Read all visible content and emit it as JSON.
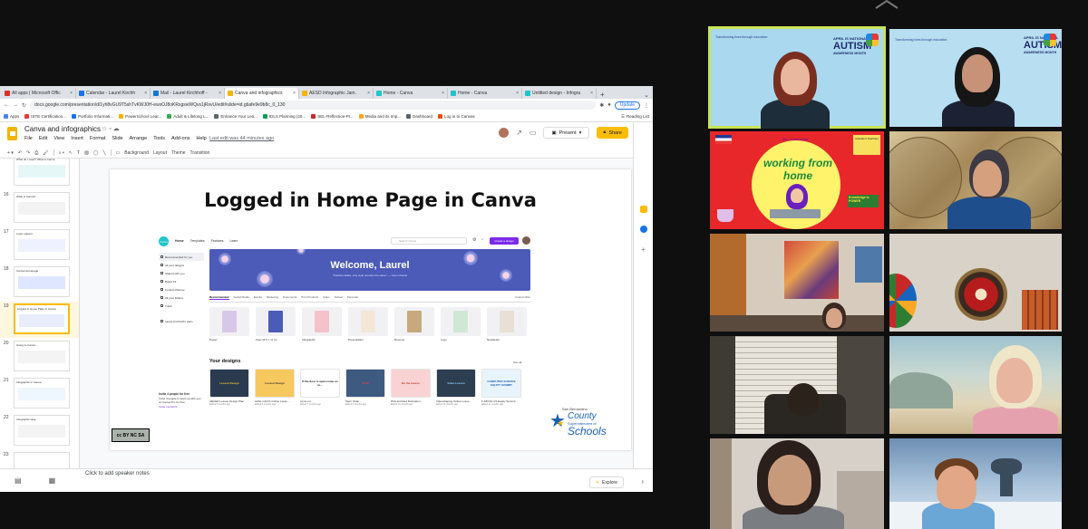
{
  "browser": {
    "tabs": [
      {
        "label": "All apps | Microsoft Offic",
        "color": "#d93025"
      },
      {
        "label": "Calendar - Laurel Kirchh",
        "color": "#1a73e8"
      },
      {
        "label": "Mail - Laurel Kirchhoff -",
        "color": "#0f78d4"
      },
      {
        "label": "Canva and infographics",
        "color": "#f4b400"
      },
      {
        "label": "AESD Infographic Jam.",
        "color": "#f4b400"
      },
      {
        "label": "Home - Canva",
        "color": "#20c4cb"
      },
      {
        "label": "Home - Canva",
        "color": "#20c4cb"
      },
      {
        "label": "Untitled design - Infogra",
        "color": "#20c4cb"
      }
    ],
    "url": "docs.google.com/presentation/d/1yh8vGU9T5shTvKWJ0H-ewxOJ8oKRxgswWQvs1jRsvU/edit#slide=id.gbafe9e9b8c_0_130",
    "update_label": "Update",
    "bookmarks": [
      "Apps",
      "ISTE Certification...",
      "Portfolio Informati...",
      "PowerSchool Lear...",
      "Adult & Lifelong L...",
      "Enhance Your Lea...",
      "IDLS Planning (20...",
      "SEL-Reflection-Pr...",
      "Media and its Imp...",
      "Dashboard",
      "Log in to Canvas"
    ],
    "reading_list": "Reading List"
  },
  "slides": {
    "title": "Canva and infographics",
    "menus": [
      "File",
      "Edit",
      "View",
      "Insert",
      "Format",
      "Slide",
      "Arrange",
      "Tools",
      "Add-ons",
      "Help"
    ],
    "last_edit": "Last edit was 44 minutes ago",
    "present_label": "Present",
    "share_label": "Share",
    "toolbar": [
      "Background",
      "Layout",
      "Theme",
      "Transition"
    ],
    "thumbnails": [
      {
        "num": "15",
        "title": "What do I need? What is Canva"
      },
      {
        "num": "16",
        "title": "What is Canva?"
      },
      {
        "num": "17",
        "title": "Login options"
      },
      {
        "num": "18",
        "title": "Canva Homepage"
      },
      {
        "num": "19",
        "title": "Logged in Home Page in Canva",
        "selected": true
      },
      {
        "num": "20",
        "title": "Going to Canva..."
      },
      {
        "num": "21",
        "title": "Infographic in Canva"
      },
      {
        "num": "22",
        "title": "Infographic idea"
      },
      {
        "num": "23",
        "title": ""
      }
    ],
    "speaker_notes": "Click to add speaker notes",
    "explore_label": "Explore"
  },
  "slide": {
    "title": "Logged in Home Page in Canva",
    "canva": {
      "logo": "Canva",
      "nav": [
        "Home",
        "Templates",
        "Features",
        "Learn"
      ],
      "search_placeholder": "Search Canva",
      "create_label": "Create a design",
      "sidebar": [
        "Recommended for you",
        "All your designs",
        "Shared with you",
        "Brand Kit",
        "Content Planner",
        "All your folders",
        "Trash",
        "Laurel Kirchhoff's team"
      ],
      "welcome": "Welcome, Laurel",
      "quote": "\"Fashion fades, only style remains the same\" — Coco Chanel",
      "categories": [
        "Recommended",
        "Social Media",
        "Events",
        "Marketing",
        "Documents",
        "Print Products",
        "Video",
        "School",
        "Personal",
        "Custom Size"
      ],
      "templates": [
        "Poster",
        "Flyer (8.5 × 11 in)",
        "Infographic",
        "Presentation",
        "Resume",
        "Logo",
        "Newsletter"
      ],
      "your_designs": "Your designs",
      "see_all": "See all",
      "designs": [
        {
          "label": "IJECED Lesson Design Plan",
          "meta": "Edited 5 months ago",
          "text": "Lesson Design",
          "bg": "#2a3b4f",
          "fg": "#f1c232"
        },
        {
          "label": "AASL CA/CS Online Lesso...",
          "meta": "Edited 6 months ago",
          "text": "Lesson Design",
          "bg": "#f6c95f",
          "fg": "#333"
        },
        {
          "label": "come on...",
          "meta": "Edited 7 months ago",
          "text": "If the door is open come on in...",
          "bg": "#ffffff",
          "fg": "#111"
        },
        {
          "label": "Stern Stran...",
          "meta": "Edited 9 months ago",
          "text": "STOP",
          "bg": "#3d5a80",
          "fg": "#e63946"
        },
        {
          "label": "Pink and Red Illustration...",
          "meta": "Edited 10 months ago",
          "text": "Be the reason",
          "bg": "#f9d3d3",
          "fg": "#c0392b"
        },
        {
          "label": "Videoshaping Online Lesso...",
          "meta": "Edited 11 months ago",
          "text": "Video Lesson",
          "bg": "#2c3e50",
          "fg": "#8fd3fe"
        },
        {
          "label": "F-18CSS CS Equity Summit...",
          "meta": "Edited 11 months ago",
          "text": "COMPUTER SCIENCE EQUITY SUMMIT",
          "bg": "#e8f4fb",
          "fg": "#1a5fb4"
        }
      ],
      "invite_title": "Invite 4 people for free",
      "invite_text": "Invite 4 people to team up with you on Canva Pro for free.",
      "invite_link": "Invite members"
    },
    "license": "cc BY NC SA",
    "sbcss": {
      "line1": "San Bernardino",
      "line2": "County",
      "line3": "Superintendent of",
      "line4": "Schools"
    }
  },
  "meeting": {
    "tiles": [
      {
        "name": "tile-participant-1",
        "kind": "autism",
        "speaking": true
      },
      {
        "name": "tile-participant-2",
        "kind": "autism"
      },
      {
        "name": "tile-participant-3",
        "kind": "bitmoji"
      },
      {
        "name": "tile-participant-4",
        "kind": "map"
      },
      {
        "name": "tile-participant-5",
        "kind": "room"
      },
      {
        "name": "tile-participant-6",
        "kind": "wall"
      },
      {
        "name": "tile-participant-7",
        "kind": "blinds"
      },
      {
        "name": "tile-participant-8",
        "kind": "mural"
      },
      {
        "name": "tile-participant-9",
        "kind": "room2"
      },
      {
        "name": "tile-participant-10",
        "kind": "fantasy"
      }
    ],
    "autism_tagline": "Transforming lives through education",
    "autism_l1": "APRIL IS NATIONAL",
    "autism_l2": "AUTISM",
    "autism_l3": "AWARENESS MONTH",
    "bitmoji_text": "working from home",
    "bitmoji_name": "Ms. Underwood",
    "bitmoji_badge": "Knowledge is POWER",
    "bitmoji_note": "Aristotle's Teachers"
  }
}
